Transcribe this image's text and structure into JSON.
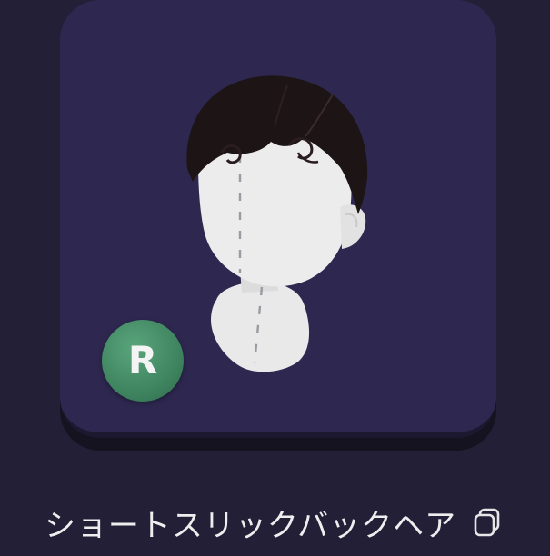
{
  "item": {
    "name": "ショートスリックバックヘア",
    "rarity_letter": "R",
    "rarity_color": "#3f8560",
    "card_color": "#2e2850",
    "background_color": "#221f37"
  },
  "icons": {
    "copy": "copy-icon",
    "preview": "hair-preview-figure"
  }
}
